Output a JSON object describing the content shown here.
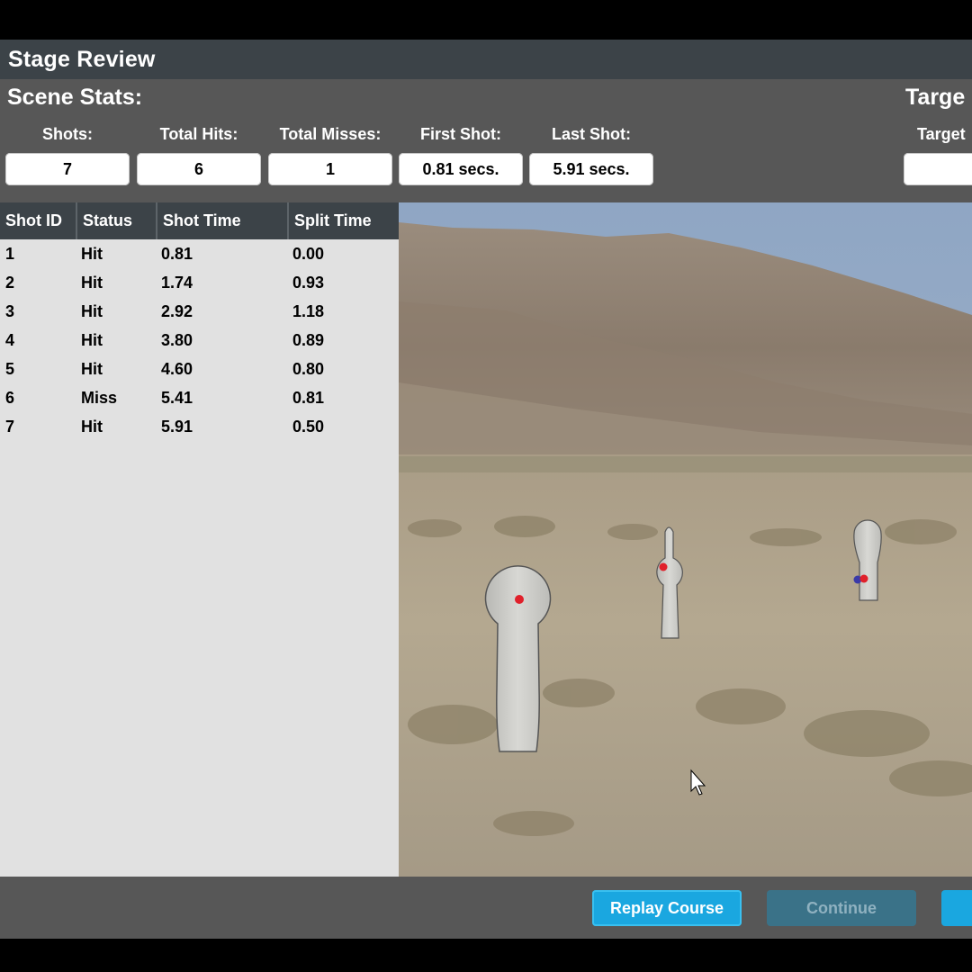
{
  "window": {
    "title": "Stage Review"
  },
  "scene_stats": {
    "heading": "Scene Stats:",
    "stats": [
      {
        "label": "Shots:",
        "value": "7"
      },
      {
        "label": "Total Hits:",
        "value": "6"
      },
      {
        "label": "Total Misses:",
        "value": "1"
      },
      {
        "label": "First Shot:",
        "value": "0.81 secs."
      },
      {
        "label": "Last Shot:",
        "value": "5.91 secs."
      }
    ]
  },
  "target_stats": {
    "heading": "Targe",
    "label": "Target"
  },
  "shot_table": {
    "columns": [
      "Shot ID",
      "Status",
      "Shot Time",
      "Split Time"
    ],
    "rows": [
      [
        "1",
        "Hit",
        "0.81",
        "0.00"
      ],
      [
        "2",
        "Hit",
        "1.74",
        "0.93"
      ],
      [
        "3",
        "Hit",
        "2.92",
        "1.18"
      ],
      [
        "4",
        "Hit",
        "3.80",
        "0.89"
      ],
      [
        "5",
        "Hit",
        "4.60",
        "0.80"
      ],
      [
        "6",
        "Miss",
        "5.41",
        "0.81"
      ],
      [
        "7",
        "Hit",
        "5.91",
        "0.50"
      ]
    ]
  },
  "actions": {
    "replay_label": "Replay Course",
    "continue_label": "Continue"
  },
  "colors": {
    "titlebar": "#3c4348",
    "panel": "#575757",
    "table_bg": "#e1e1e1",
    "accent": "#1aa7e0",
    "hit_marker": "#e0202a",
    "miss_marker": "#3a3aa8"
  }
}
